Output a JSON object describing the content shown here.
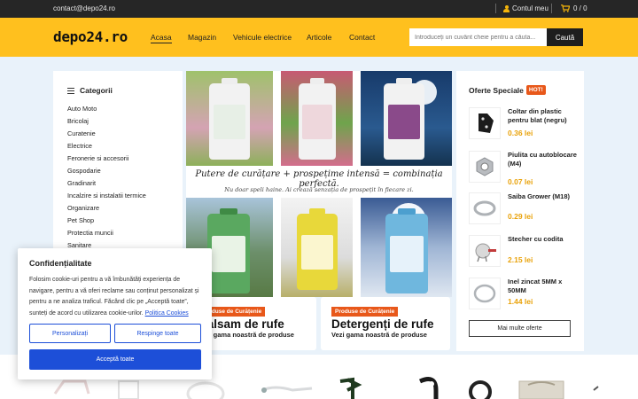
{
  "topbar": {
    "email": "contact@depo24.ro",
    "account_label": "Contul meu",
    "cart_count": "0 / 0"
  },
  "header": {
    "logo": "depo24.ro",
    "nav": [
      "Acasa",
      "Magazin",
      "Vehicule electrice",
      "Articole",
      "Contact"
    ],
    "active_nav": "Acasa",
    "search_placeholder": "Introduceți un cuvânt cheie pentru a căuta...",
    "search_button": "Caută"
  },
  "categories": {
    "title": "Categorii",
    "items": [
      "Auto Moto",
      "Bricolaj",
      "Curatenie",
      "Electrice",
      "Feronerie si accesorii",
      "Gospodarie",
      "Gradinarit",
      "Incalzire si instalatii termice",
      "Organizare",
      "Pet Shop",
      "Protectia muncii",
      "Sanitare"
    ]
  },
  "banner": {
    "line1": "Putere de curățare + prospețime intensă = combinația perfectă.",
    "line2": "Nu doar speli haine. Ai crează senzația de prospețit în fiecare zi."
  },
  "promos": [
    {
      "tag": "Produse de Curățenie",
      "title": "Balsam de rufe",
      "subtitle": "Vezi gama noastră de produse"
    },
    {
      "tag": "Produse de Curățenie",
      "title": "Detergenți de rufe",
      "subtitle": "Vezi gama noastră de produse"
    }
  ],
  "offers": {
    "title": "Oferte Speciale",
    "badge": "HOT!",
    "items": [
      {
        "name": "Coltar din plastic pentru blat (negru)",
        "price": "0.36 lei",
        "icon": "corner-bracket-icon"
      },
      {
        "name": "Piulita cu autoblocare (M4)",
        "price": "0.07 lei",
        "icon": "lock-nut-icon"
      },
      {
        "name": "Saiba Grower (M18)",
        "price": "0.29 lei",
        "icon": "spring-washer-icon"
      },
      {
        "name": "Stecher cu codita",
        "price": "2.15 lei",
        "icon": "plug-icon"
      },
      {
        "name": "Inel zincat 5MM x 50MM",
        "price": "1.44 lei",
        "icon": "ring-icon"
      }
    ],
    "more_button": "Mai multe oferte"
  },
  "cookie": {
    "title": "Confidențialitate",
    "text": "Folosim cookie-uri pentru a vă îmbunătăți experiența de navigare, pentru a vă oferi reclame sau conținut personalizat și pentru a ne analiza traficul. Făcând clic pe „Acceptă toate”, sunteți de acord cu utilizarea cookie-urilor.",
    "link": "Politica Cookies",
    "customize": "Personalizați",
    "reject": "Respinge toate",
    "accept": "Acceptă toate"
  },
  "colors": {
    "header_yellow": "#ffc01e",
    "price_orange": "#e9a20a",
    "tag_orange": "#e8581a",
    "cookie_blue": "#1d4fd8"
  }
}
